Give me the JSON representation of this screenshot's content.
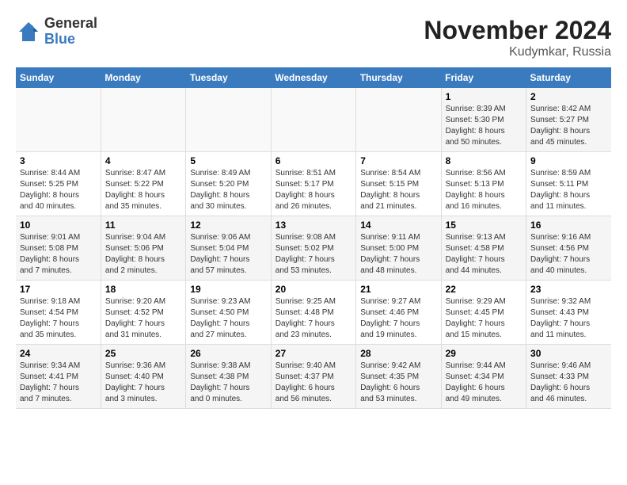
{
  "logo": {
    "general": "General",
    "blue": "Blue"
  },
  "title": "November 2024",
  "location": "Kudymkar, Russia",
  "headers": [
    "Sunday",
    "Monday",
    "Tuesday",
    "Wednesday",
    "Thursday",
    "Friday",
    "Saturday"
  ],
  "weeks": [
    [
      {
        "day": "",
        "info": ""
      },
      {
        "day": "",
        "info": ""
      },
      {
        "day": "",
        "info": ""
      },
      {
        "day": "",
        "info": ""
      },
      {
        "day": "",
        "info": ""
      },
      {
        "day": "1",
        "info": "Sunrise: 8:39 AM\nSunset: 5:30 PM\nDaylight: 8 hours\nand 50 minutes."
      },
      {
        "day": "2",
        "info": "Sunrise: 8:42 AM\nSunset: 5:27 PM\nDaylight: 8 hours\nand 45 minutes."
      }
    ],
    [
      {
        "day": "3",
        "info": "Sunrise: 8:44 AM\nSunset: 5:25 PM\nDaylight: 8 hours\nand 40 minutes."
      },
      {
        "day": "4",
        "info": "Sunrise: 8:47 AM\nSunset: 5:22 PM\nDaylight: 8 hours\nand 35 minutes."
      },
      {
        "day": "5",
        "info": "Sunrise: 8:49 AM\nSunset: 5:20 PM\nDaylight: 8 hours\nand 30 minutes."
      },
      {
        "day": "6",
        "info": "Sunrise: 8:51 AM\nSunset: 5:17 PM\nDaylight: 8 hours\nand 26 minutes."
      },
      {
        "day": "7",
        "info": "Sunrise: 8:54 AM\nSunset: 5:15 PM\nDaylight: 8 hours\nand 21 minutes."
      },
      {
        "day": "8",
        "info": "Sunrise: 8:56 AM\nSunset: 5:13 PM\nDaylight: 8 hours\nand 16 minutes."
      },
      {
        "day": "9",
        "info": "Sunrise: 8:59 AM\nSunset: 5:11 PM\nDaylight: 8 hours\nand 11 minutes."
      }
    ],
    [
      {
        "day": "10",
        "info": "Sunrise: 9:01 AM\nSunset: 5:08 PM\nDaylight: 8 hours\nand 7 minutes."
      },
      {
        "day": "11",
        "info": "Sunrise: 9:04 AM\nSunset: 5:06 PM\nDaylight: 8 hours\nand 2 minutes."
      },
      {
        "day": "12",
        "info": "Sunrise: 9:06 AM\nSunset: 5:04 PM\nDaylight: 7 hours\nand 57 minutes."
      },
      {
        "day": "13",
        "info": "Sunrise: 9:08 AM\nSunset: 5:02 PM\nDaylight: 7 hours\nand 53 minutes."
      },
      {
        "day": "14",
        "info": "Sunrise: 9:11 AM\nSunset: 5:00 PM\nDaylight: 7 hours\nand 48 minutes."
      },
      {
        "day": "15",
        "info": "Sunrise: 9:13 AM\nSunset: 4:58 PM\nDaylight: 7 hours\nand 44 minutes."
      },
      {
        "day": "16",
        "info": "Sunrise: 9:16 AM\nSunset: 4:56 PM\nDaylight: 7 hours\nand 40 minutes."
      }
    ],
    [
      {
        "day": "17",
        "info": "Sunrise: 9:18 AM\nSunset: 4:54 PM\nDaylight: 7 hours\nand 35 minutes."
      },
      {
        "day": "18",
        "info": "Sunrise: 9:20 AM\nSunset: 4:52 PM\nDaylight: 7 hours\nand 31 minutes."
      },
      {
        "day": "19",
        "info": "Sunrise: 9:23 AM\nSunset: 4:50 PM\nDaylight: 7 hours\nand 27 minutes."
      },
      {
        "day": "20",
        "info": "Sunrise: 9:25 AM\nSunset: 4:48 PM\nDaylight: 7 hours\nand 23 minutes."
      },
      {
        "day": "21",
        "info": "Sunrise: 9:27 AM\nSunset: 4:46 PM\nDaylight: 7 hours\nand 19 minutes."
      },
      {
        "day": "22",
        "info": "Sunrise: 9:29 AM\nSunset: 4:45 PM\nDaylight: 7 hours\nand 15 minutes."
      },
      {
        "day": "23",
        "info": "Sunrise: 9:32 AM\nSunset: 4:43 PM\nDaylight: 7 hours\nand 11 minutes."
      }
    ],
    [
      {
        "day": "24",
        "info": "Sunrise: 9:34 AM\nSunset: 4:41 PM\nDaylight: 7 hours\nand 7 minutes."
      },
      {
        "day": "25",
        "info": "Sunrise: 9:36 AM\nSunset: 4:40 PM\nDaylight: 7 hours\nand 3 minutes."
      },
      {
        "day": "26",
        "info": "Sunrise: 9:38 AM\nSunset: 4:38 PM\nDaylight: 7 hours\nand 0 minutes."
      },
      {
        "day": "27",
        "info": "Sunrise: 9:40 AM\nSunset: 4:37 PM\nDaylight: 6 hours\nand 56 minutes."
      },
      {
        "day": "28",
        "info": "Sunrise: 9:42 AM\nSunset: 4:35 PM\nDaylight: 6 hours\nand 53 minutes."
      },
      {
        "day": "29",
        "info": "Sunrise: 9:44 AM\nSunset: 4:34 PM\nDaylight: 6 hours\nand 49 minutes."
      },
      {
        "day": "30",
        "info": "Sunrise: 9:46 AM\nSunset: 4:33 PM\nDaylight: 6 hours\nand 46 minutes."
      }
    ]
  ]
}
